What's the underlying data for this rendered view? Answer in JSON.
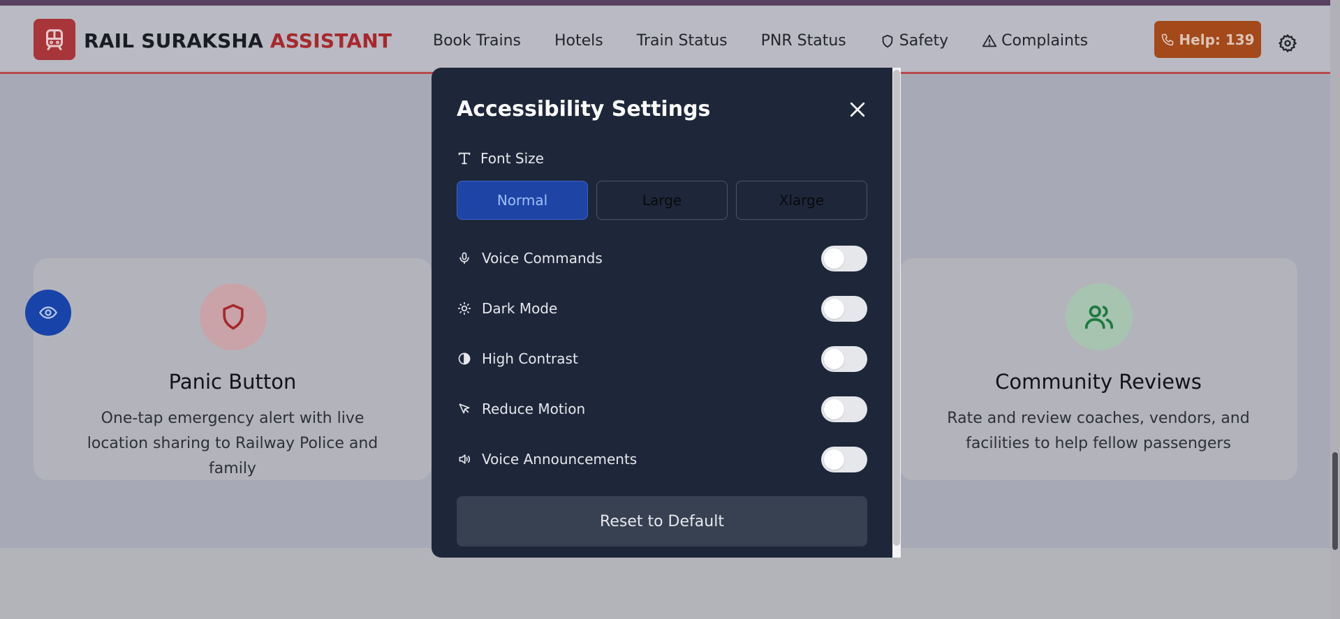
{
  "header": {
    "brand_part1": "RAIL SURAKSHA",
    "brand_part2": "ASSISTANT",
    "nav": {
      "book_trains": "Book Trains",
      "hotels": "Hotels",
      "train_status": "Train Status",
      "pnr_status": "PNR Status",
      "safety": "Safety",
      "complaints": "Complaints"
    },
    "help_label": "Help: 139"
  },
  "cards": {
    "panic": {
      "title": "Panic Button",
      "description": "One-tap emergency alert with live location sharing to Railway Police and family"
    },
    "community": {
      "title": "Community Reviews",
      "description": "Rate and review coaches, vendors, and facilities to help fellow passengers"
    }
  },
  "modal": {
    "title": "Accessibility Settings",
    "font_size": {
      "label": "Font Size",
      "options": [
        "Normal",
        "Large",
        "Xlarge"
      ],
      "selected": "Normal"
    },
    "toggles": [
      {
        "label": "Voice Commands",
        "icon": "mic-icon",
        "on": false
      },
      {
        "label": "Dark Mode",
        "icon": "sun-icon",
        "on": false
      },
      {
        "label": "High Contrast",
        "icon": "contrast-icon",
        "on": false
      },
      {
        "label": "Reduce Motion",
        "icon": "pointer-icon",
        "on": false
      },
      {
        "label": "Voice Announcements",
        "icon": "speaker-icon",
        "on": false
      }
    ],
    "reset_label": "Reset to Default"
  },
  "colors": {
    "brand_red": "#a7282c",
    "help_orange": "#a3491a",
    "modal_bg": "#1e2739",
    "active_option": "#1e44a6",
    "accessibility_fab": "#1843a9"
  }
}
